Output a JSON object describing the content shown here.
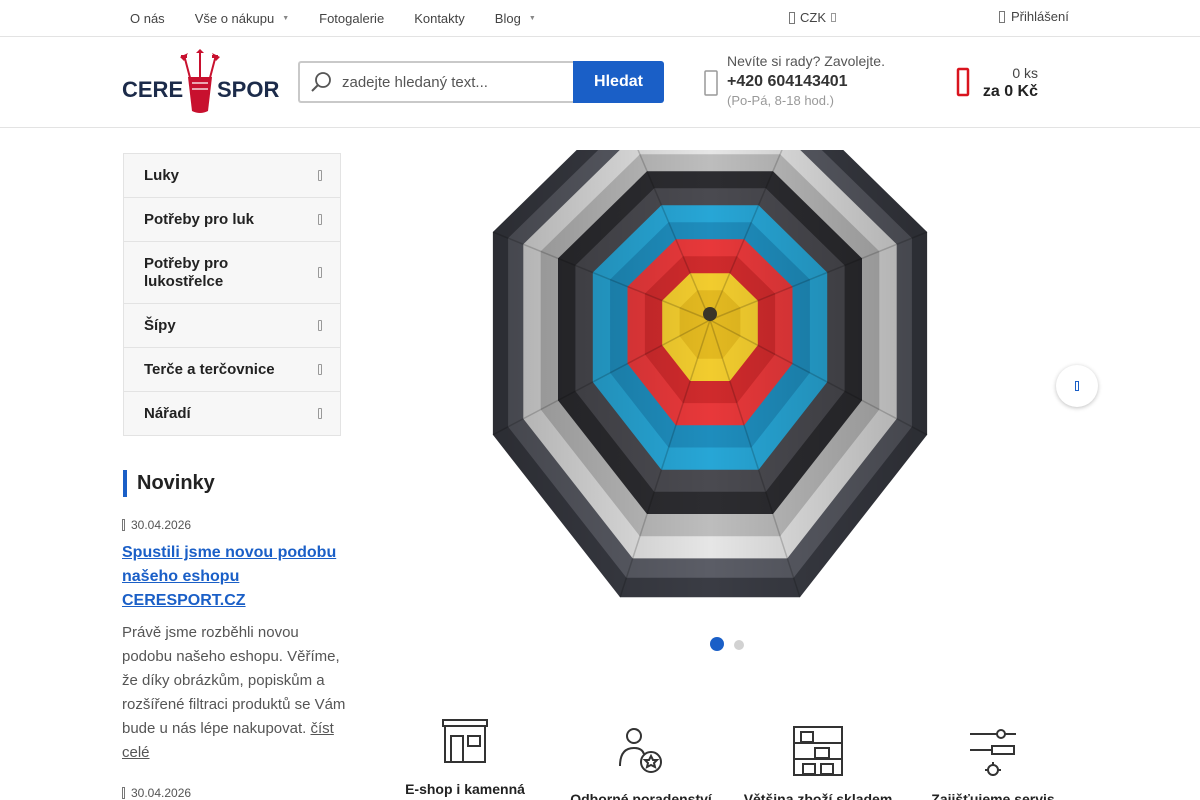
{
  "topbar": {
    "nav": [
      {
        "label": "O nás",
        "caret": false
      },
      {
        "label": "Vše o nákupu",
        "caret": true
      },
      {
        "label": "Fotogalerie",
        "caret": false
      },
      {
        "label": "Kontakty",
        "caret": false
      },
      {
        "label": "Blog",
        "caret": true
      }
    ],
    "currency": "CZK",
    "login": "Přihlášení"
  },
  "header": {
    "logo": {
      "left": "CERE",
      "right": "SPORT"
    },
    "search": {
      "placeholder": "zadejte hledaný text...",
      "button": "Hledat"
    },
    "help": {
      "question": "Nevíte si rady? Zavolejte.",
      "phone": "+420 604143401",
      "hours": "(Po-Pá, 8-18 hod.)"
    },
    "cart": {
      "count": "0 ks",
      "price": "za 0 Kč"
    }
  },
  "categories": [
    {
      "label": "Luky"
    },
    {
      "label": "Potřeby pro luk"
    },
    {
      "label": "Potřeby pro lukostřelce"
    },
    {
      "label": "Šípy"
    },
    {
      "label": "Terče a terčovnice"
    },
    {
      "label": "Nářadí"
    }
  ],
  "news": {
    "title": "Novinky",
    "items": [
      {
        "date": "30.04.2026",
        "headline": "Spustili jsme novou podobu našeho eshopu CERESPORT.CZ",
        "text": "Právě jsme rozběhli novou podobu našeho eshopu. Věříme, že díky obrázkům, popiskům a rozšířené filtraci produktů se Vám bude u nás lépe nakupovat.",
        "more": "číst celé"
      },
      {
        "date": "30.04.2026"
      }
    ]
  },
  "slider": {
    "active_slide": 1,
    "total_slides": 2
  },
  "features": [
    {
      "label": "E-shop i kamenná",
      "icon": "store-icon"
    },
    {
      "label": "Odborné poradenství",
      "icon": "expert-icon"
    },
    {
      "label": "Většina zboží skladem",
      "icon": "warehouse-icon"
    },
    {
      "label": "Zajišťujeme servis",
      "icon": "tools-icon"
    }
  ],
  "colors": {
    "accent": "#1a5fc7",
    "cart": "#d9141e",
    "logo_red": "#c8102e",
    "logo_navy": "#1c2b4a"
  }
}
